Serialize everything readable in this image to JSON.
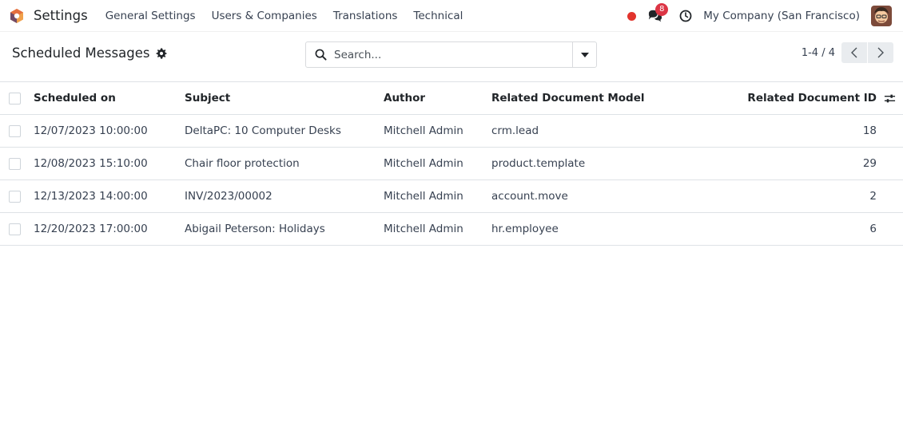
{
  "navbar": {
    "app_name": "Settings",
    "menu": [
      "General Settings",
      "Users & Companies",
      "Translations",
      "Technical"
    ],
    "chat_count": "8",
    "company": "My Company (San Francisco)"
  },
  "control": {
    "title": "Scheduled Messages",
    "search_placeholder": "Search...",
    "pager": "1-4 / 4"
  },
  "table": {
    "columns": [
      "Scheduled on",
      "Subject",
      "Author",
      "Related Document Model",
      "Related Document ID"
    ],
    "rows": [
      [
        "12/07/2023 10:00:00",
        "DeltaPC: 10 Computer Desks",
        "Mitchell Admin",
        "crm.lead",
        "18"
      ],
      [
        "12/08/2023 15:10:00",
        "Chair floor protection",
        "Mitchell Admin",
        "product.template",
        "29"
      ],
      [
        "12/13/2023 14:00:00",
        "INV/2023/00002",
        "Mitchell Admin",
        "account.move",
        "2"
      ],
      [
        "12/20/2023 17:00:00",
        "Abigail Peterson: Holidays",
        "Mitchell Admin",
        "hr.employee",
        "6"
      ]
    ]
  },
  "icons": {
    "app_logo": "odoo-logo-icon",
    "recording": "record-dot-icon",
    "chat": "chat-icon",
    "activity": "clock-icon",
    "avatar": "user-avatar",
    "settings": "gear-icon",
    "search": "search-icon",
    "toggle": "caret-down-icon",
    "prev": "chevron-left-icon",
    "next": "chevron-right-icon",
    "columns": "sliders-icon"
  },
  "colors": {
    "rec_dot": "#e2342d",
    "badge": "#dc3545",
    "logo_orange": "#f0a04b",
    "logo_purple": "#714b67"
  }
}
